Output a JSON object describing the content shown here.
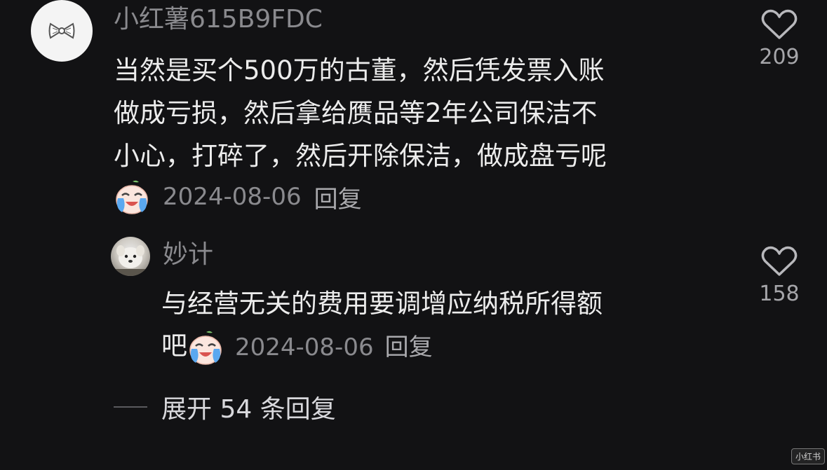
{
  "comment": {
    "username": "小红薯615B9FDC",
    "text_lines": [
      "当然是买个500万的古董，然后凭发票入账",
      "做成亏损，然后拿给赝品等2年公司保洁不",
      "小心，打碎了，然后开除保洁，做成盘亏呢"
    ],
    "emoji_icon": "crying-laughing-face-icon",
    "date": "2024-08-06",
    "reply_label": "回复",
    "likes": "209"
  },
  "reply": {
    "username": "妙计",
    "text_line1": "与经营无关的费用要调增应纳税所得额",
    "text_line2": "吧",
    "emoji_icon": "crying-laughing-face-icon",
    "date": "2024-08-06",
    "reply_label": "回复",
    "likes": "158"
  },
  "expand_label": "展开 54 条回复",
  "watermark": "小红书"
}
